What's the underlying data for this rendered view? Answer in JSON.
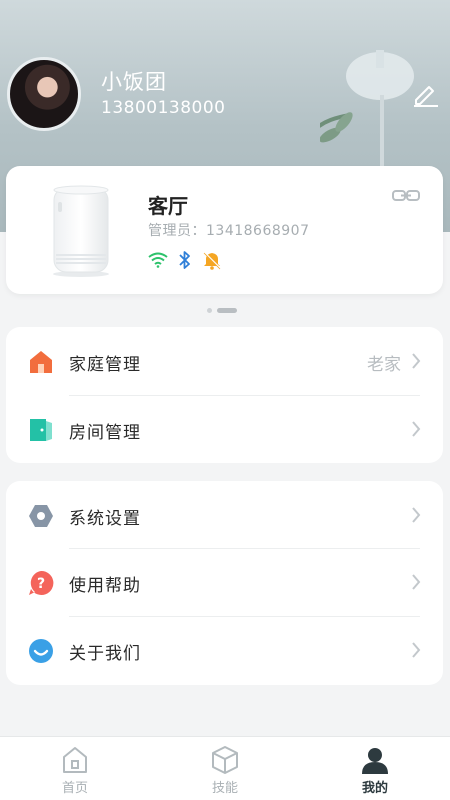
{
  "profile": {
    "name": "小饭团",
    "phone": "13800138000"
  },
  "device": {
    "room": "客厅",
    "admin_label": "管理员：13418668907",
    "status_icons": [
      "wifi-icon",
      "bluetooth-icon",
      "bell-mute-icon"
    ]
  },
  "carousel": {
    "pages": 2,
    "active": 2
  },
  "menu_group_1": [
    {
      "label": "家庭管理",
      "value": "老家",
      "icon": "home-icon"
    },
    {
      "label": "房间管理",
      "value": "",
      "icon": "door-icon"
    }
  ],
  "menu_group_2": [
    {
      "label": "系统设置",
      "icon": "settings-hex-icon"
    },
    {
      "label": "使用帮助",
      "icon": "help-icon"
    },
    {
      "label": "关于我们",
      "icon": "smile-icon"
    }
  ],
  "tabs": [
    {
      "label": "首页",
      "icon": "home-tab-icon"
    },
    {
      "label": "技能",
      "icon": "skill-cube-icon"
    },
    {
      "label": "我的",
      "icon": "profile-tab-icon",
      "active": true
    }
  ],
  "colors": {
    "wifi": "#2dc26b",
    "bluetooth": "#2f7fd8",
    "bell": "#f5a623",
    "home": "#f26d3d",
    "door": "#23c1a6",
    "settings": "#8795a6",
    "help": "#f4645b",
    "about": "#3aa0e6"
  }
}
